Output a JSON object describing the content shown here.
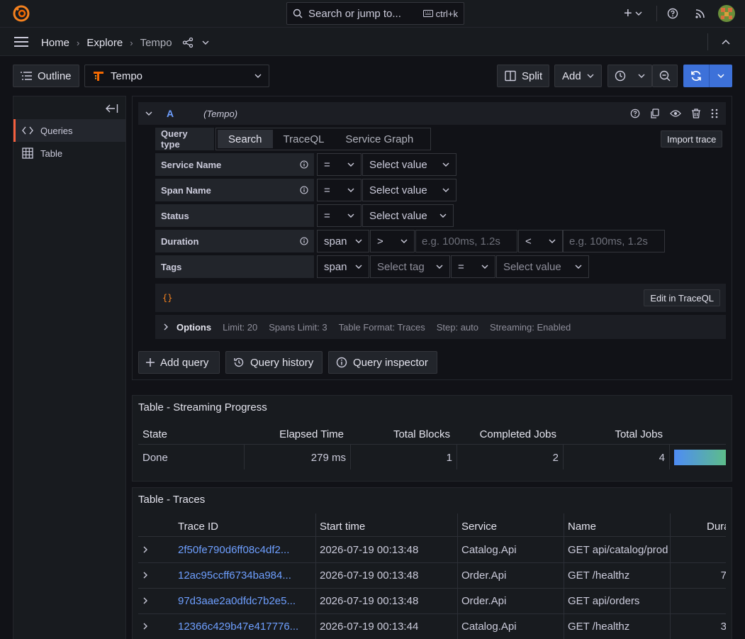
{
  "topbar": {
    "search_placeholder": "Search or jump to...",
    "shortcut": "ctrl+k"
  },
  "breadcrumb": {
    "home": "Home",
    "explore": "Explore",
    "current": "Tempo"
  },
  "toolbar": {
    "outline_label": "Outline",
    "datasource": "Tempo",
    "split_label": "Split",
    "add_label": "Add"
  },
  "outline": {
    "items": [
      {
        "label": "Queries",
        "icon": "code-icon",
        "active": true
      },
      {
        "label": "Table",
        "icon": "table-icon",
        "active": false
      }
    ]
  },
  "query": {
    "ref_id": "A",
    "datasource_hint": "(Tempo)",
    "query_type_label": "Query type",
    "query_types": [
      "Search",
      "TraceQL",
      "Service Graph"
    ],
    "active_type": "Search",
    "import_trace": "Import trace",
    "fields": {
      "service_name": "Service Name",
      "span_name": "Span Name",
      "status": "Status",
      "duration": "Duration",
      "tags": "Tags"
    },
    "operator_eq": "=",
    "operator_gt": ">",
    "operator_lt": "<",
    "select_value": "Select value",
    "select_tag": "Select tag",
    "scope_span": "span",
    "duration_placeholder": "e.g. 100ms, 1.2s",
    "traceql_preview": "{}",
    "edit_in_traceql": "Edit in TraceQL",
    "options": {
      "label": "Options",
      "limit": "Limit: 20",
      "spans_limit": "Spans Limit: 3",
      "table_format": "Table Format: Traces",
      "step": "Step: auto",
      "streaming": "Streaming: Enabled"
    },
    "add_query": "Add query",
    "query_history": "Query history",
    "query_inspector": "Query inspector"
  },
  "progress_table": {
    "title": "Table - Streaming Progress",
    "columns": [
      "State",
      "Elapsed Time",
      "Total Blocks",
      "Completed Jobs",
      "Total Jobs"
    ],
    "row": [
      "Done",
      "279 ms",
      "1",
      "2",
      "4"
    ]
  },
  "traces_table": {
    "title": "Table - Traces",
    "columns": [
      "Trace ID",
      "Start time",
      "Service",
      "Name",
      "Dura"
    ],
    "rows": [
      {
        "id": "2f50fe790d6ff08c4df2...",
        "start": "2026-07-19 00:13:48",
        "service": "Catalog.Api",
        "name": "GET api/catalog/prod",
        "dur": ""
      },
      {
        "id": "12ac95ccff6734ba984...",
        "start": "2026-07-19 00:13:48",
        "service": "Order.Api",
        "name": "GET /healthz",
        "dur": "7"
      },
      {
        "id": "97d3aae2a0dfdc7b2e5...",
        "start": "2026-07-19 00:13:48",
        "service": "Order.Api",
        "name": "GET api/orders",
        "dur": ""
      },
      {
        "id": "12366c429b47e417776...",
        "start": "2026-07-19 00:13:44",
        "service": "Catalog.Api",
        "name": "GET /healthz",
        "dur": "3"
      }
    ]
  },
  "colors": {
    "accent_orange": "#f55f3e",
    "primary_blue": "#3d71d9",
    "link_blue": "#6e9fff"
  }
}
